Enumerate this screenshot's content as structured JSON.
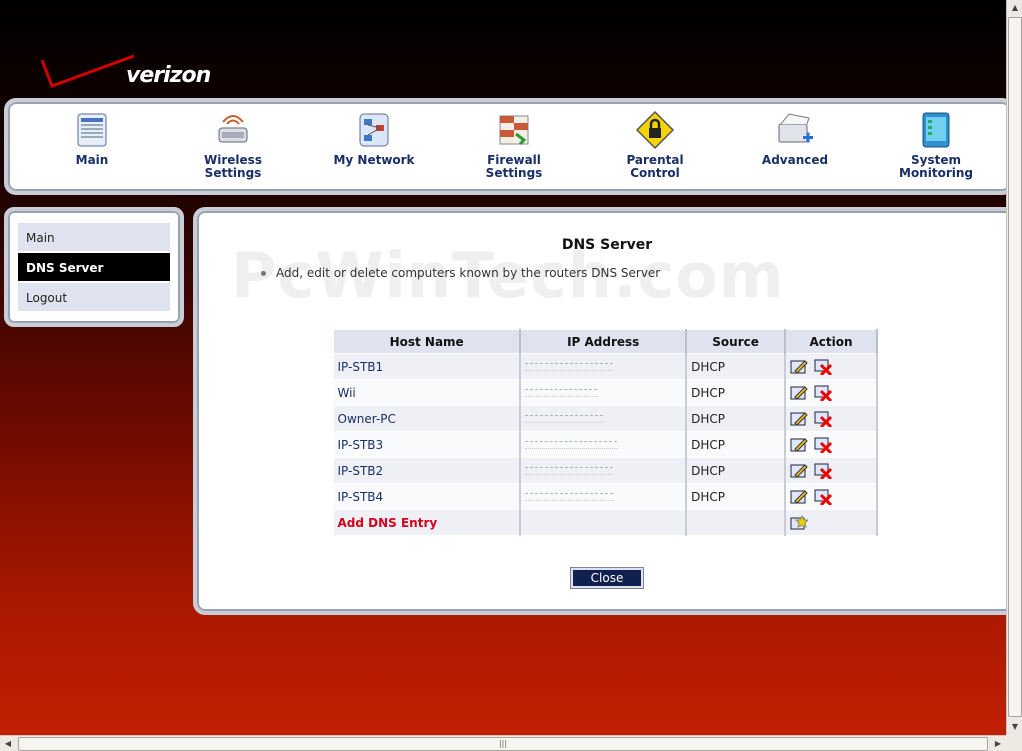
{
  "brand": {
    "logo_text": "verizon"
  },
  "topnav": [
    {
      "label": "Main",
      "icon": "main-icon"
    },
    {
      "label": "Wireless\nSettings",
      "icon": "wireless-icon"
    },
    {
      "label": "My Network",
      "icon": "network-icon"
    },
    {
      "label": "Firewall\nSettings",
      "icon": "firewall-icon"
    },
    {
      "label": "Parental\nControl",
      "icon": "lock-icon"
    },
    {
      "label": "Advanced",
      "icon": "advanced-icon"
    },
    {
      "label": "System\nMonitoring",
      "icon": "monitor-icon"
    }
  ],
  "sidebar": {
    "items": [
      {
        "label": "Main",
        "active": false
      },
      {
        "label": "DNS Server",
        "active": true
      },
      {
        "label": "Logout",
        "active": false
      }
    ]
  },
  "main": {
    "watermark": "PcWinTech.com",
    "title": "DNS Server",
    "description": "Add, edit or delete computers known by the routers DNS Server",
    "table": {
      "headers": [
        "Host Name",
        "IP Address",
        "Source",
        "Action"
      ],
      "rows": [
        {
          "host": "IP-STB1",
          "source": "DHCP"
        },
        {
          "host": "Wii",
          "source": "DHCP"
        },
        {
          "host": "Owner-PC",
          "source": "DHCP"
        },
        {
          "host": "IP-STB3",
          "source": "DHCP"
        },
        {
          "host": "IP-STB2",
          "source": "DHCP"
        },
        {
          "host": "IP-STB4",
          "source": "DHCP"
        }
      ],
      "add_label": "Add DNS Entry"
    },
    "close_label": "Close"
  },
  "colors": {
    "nav_text": "#1a2f66",
    "add_link": "#d4001a",
    "close_bg": "#10204f"
  }
}
